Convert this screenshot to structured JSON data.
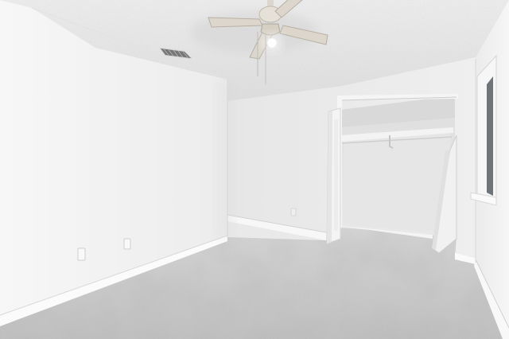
{
  "scene": {
    "subject": "empty-bedroom",
    "colors": {
      "ceiling": "#ebebeb",
      "left_wall": "#f3f3f3",
      "back_wall": "#ececec",
      "right_wall": "#efefef",
      "carpet": "#cdcdcd",
      "baseboard": "#fafafa",
      "closet_interior": "#e3e3e3",
      "fan_blade": "#dcd6cc"
    },
    "elements": [
      "ceiling-fan",
      "air-vent",
      "closet-doorway",
      "closet-shelf",
      "bifold-door-left",
      "bifold-door-right",
      "window",
      "wall-outlets",
      "baseboards",
      "carpet-floor"
    ]
  }
}
